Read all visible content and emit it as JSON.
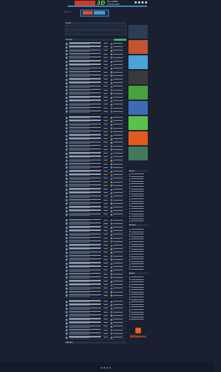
{
  "header": {
    "site_text": "Die größte Community!",
    "breadcrumb": "Forum"
  },
  "main": {
    "info_title": "Forum",
    "topics_title": "Themen",
    "stats_title": "Statistik"
  },
  "sidebar": {
    "head_1": "Partner",
    "head_2": "Neueste",
    "head_3": "Beliebt",
    "aliexpress_label": "AliExpress"
  },
  "colors": {
    "accent_blue": "#3a89c9",
    "accent_green": "#3cb371",
    "brand_orange": "#ff5a1f",
    "background": "#1a2030"
  }
}
